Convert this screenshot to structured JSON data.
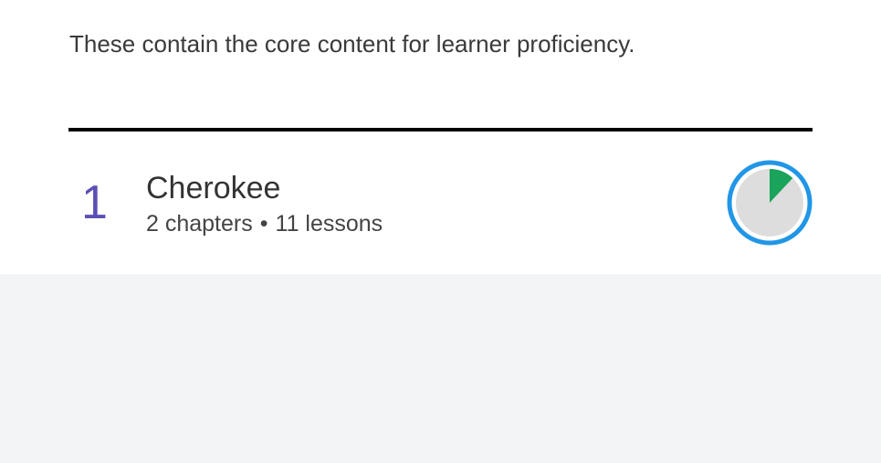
{
  "intro_text": "These contain the core content for learner proficiency.",
  "course": {
    "number": "1",
    "title": "Cherokee",
    "chapters": "2 chapters",
    "separator": "•",
    "lessons": "11 lessons",
    "progress_fraction": 0.12
  },
  "colors": {
    "number": "#5b4fb5",
    "progress_ring": "#2196e6",
    "progress_fill": "#1aa35a",
    "progress_track": "#dddddd",
    "background": "#f3f4f6"
  }
}
